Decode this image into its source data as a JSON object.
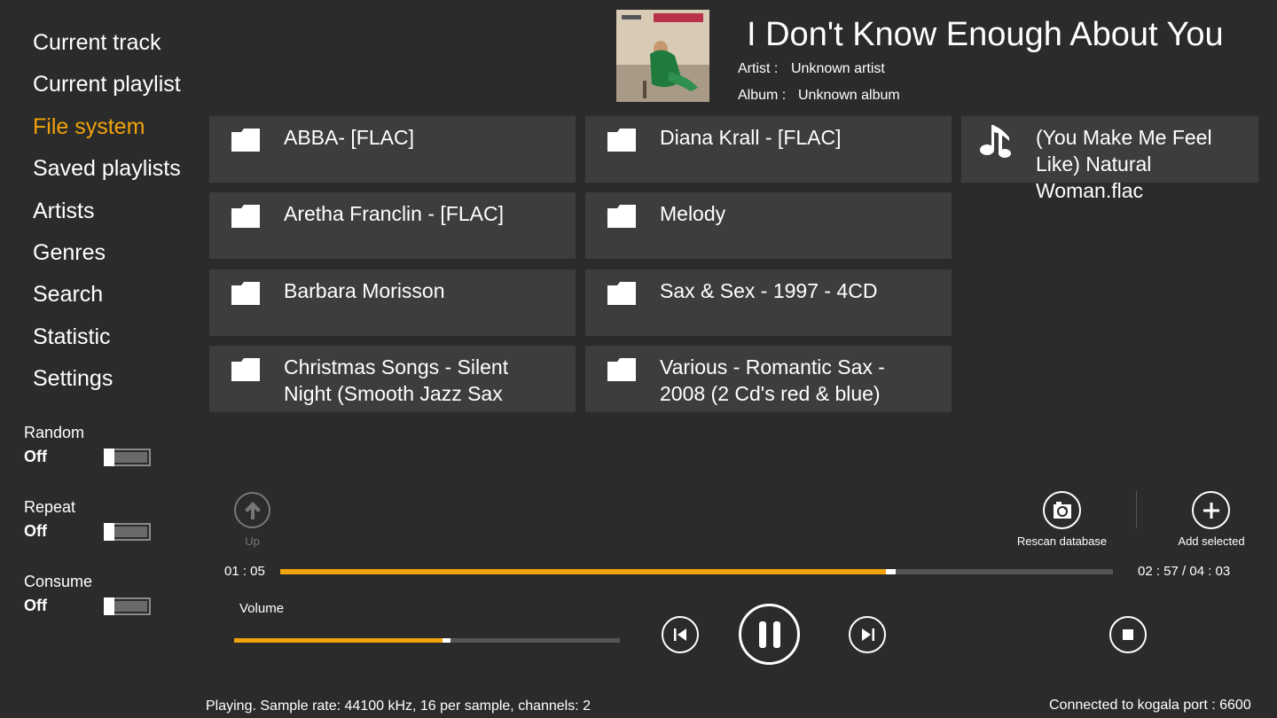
{
  "nav": {
    "items": [
      {
        "label": "Current track",
        "active": false
      },
      {
        "label": "Current playlist",
        "active": false
      },
      {
        "label": "File system",
        "active": true
      },
      {
        "label": "Saved playlists",
        "active": false
      },
      {
        "label": "Artists",
        "active": false
      },
      {
        "label": "Genres",
        "active": false
      },
      {
        "label": "Search",
        "active": false
      },
      {
        "label": "Statistic",
        "active": false
      },
      {
        "label": "Settings",
        "active": false
      }
    ]
  },
  "toggles": {
    "random": {
      "label": "Random",
      "state": "Off"
    },
    "repeat": {
      "label": "Repeat",
      "state": "Off"
    },
    "consume": {
      "label": "Consume",
      "state": "Off"
    }
  },
  "now_playing": {
    "title": "I Don't Know Enough About You",
    "artist_label": "Artist :",
    "artist": "Unknown artist",
    "album_label": "Album :",
    "album": "Unknown album"
  },
  "tiles": {
    "col1": [
      {
        "label": "ABBA- [FLAC]",
        "icon": "folder-icon"
      },
      {
        "label": "Aretha Franclin - [FLAC]",
        "icon": "folder-icon"
      },
      {
        "label": "Barbara Morisson",
        "icon": "folder-icon"
      },
      {
        "label": "Christmas Songs - Silent Night (Smooth Jazz Sax",
        "icon": "folder-icon"
      }
    ],
    "col2": [
      {
        "label": "Diana Krall - [FLAC]",
        "icon": "folder-icon"
      },
      {
        "label": "Melody",
        "icon": "folder-icon"
      },
      {
        "label": "Sax & Sex - 1997 - 4CD",
        "icon": "folder-icon"
      },
      {
        "label": "Various - Romantic Sax - 2008 (2 Cd's red & blue)",
        "icon": "folder-icon"
      }
    ],
    "col3": [
      {
        "label": "(You Make Me Feel Like) Natural Woman.flac",
        "icon": "music-note-icon"
      }
    ]
  },
  "appbar": {
    "up_label": "Up",
    "rescan_label": "Rescan database",
    "add_label": "Add selected"
  },
  "playback": {
    "elapsed": "01 : 05",
    "remaining_total": "02 : 57 / 04 : 03",
    "progress_fraction": 0.727,
    "volume_label": "Volume",
    "volume_fraction": 0.54
  },
  "status": {
    "left": "Playing.   Sample rate: 44100 kHz, 16 per sample, channels: 2",
    "right": "Connected to kogala port : 6600"
  },
  "colors": {
    "accent": "#f0a30a",
    "background": "#2b2b2b",
    "tile": "#3d3d3d"
  }
}
